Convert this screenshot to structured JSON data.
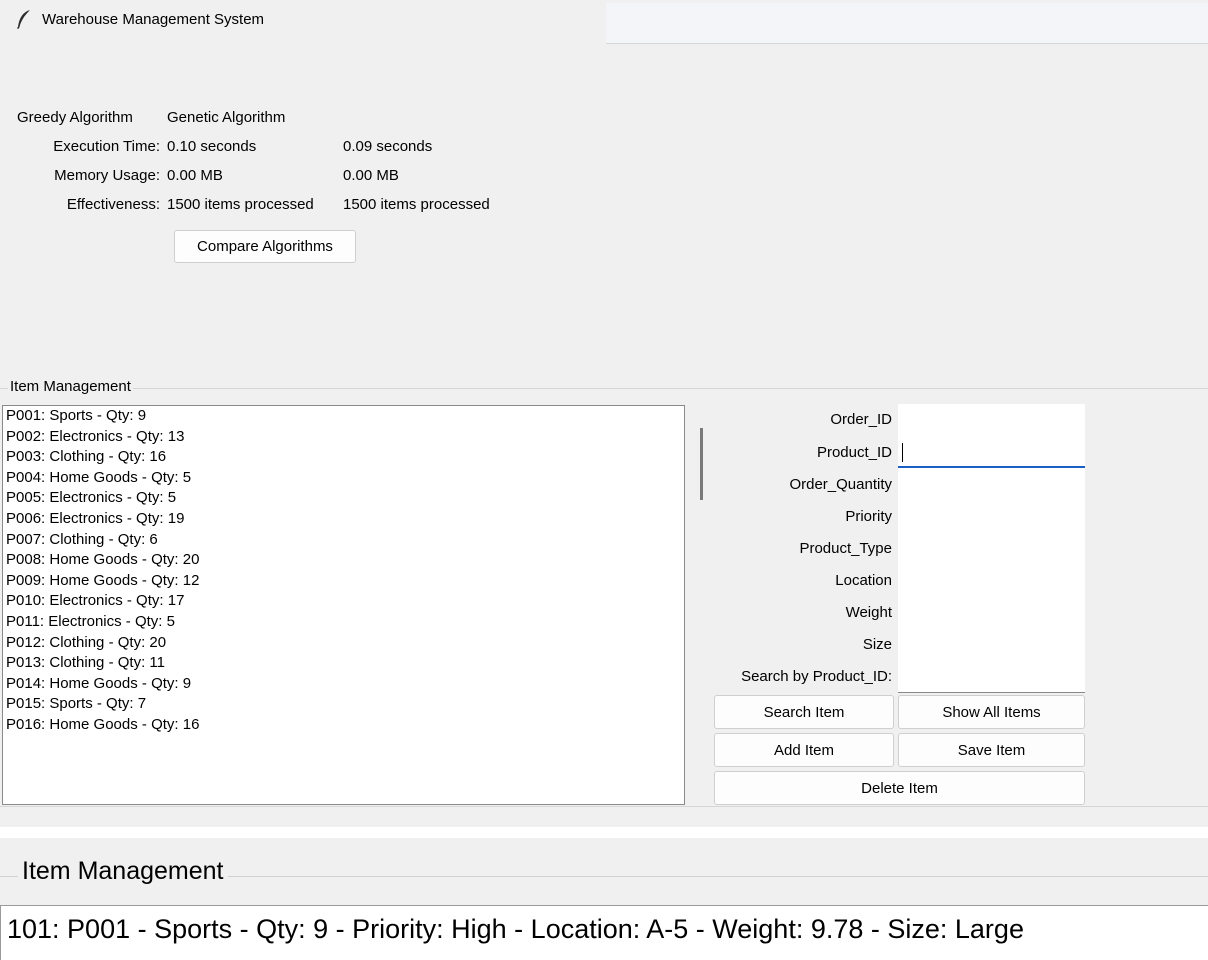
{
  "window": {
    "title": "Warehouse Management System"
  },
  "comparison": {
    "headers": {
      "greedy": "Greedy Algorithm",
      "genetic": "Genetic Algorithm"
    },
    "execution_time": {
      "label": "Execution Time:",
      "greedy": "0.10 seconds",
      "genetic": "0.09 seconds"
    },
    "memory_usage": {
      "label": "Memory Usage:",
      "greedy": "0.00 MB",
      "genetic": "0.00 MB"
    },
    "effectiveness": {
      "label": "Effectiveness:",
      "greedy": "1500 items processed",
      "genetic": "1500 items processed"
    },
    "compare_button": "Compare Algorithms"
  },
  "item_management": {
    "title": "Item Management",
    "items": [
      "P001: Sports - Qty: 9",
      "P002: Electronics - Qty: 13",
      "P003: Clothing - Qty: 16",
      "P004: Home Goods - Qty: 5",
      "P005: Electronics - Qty: 5",
      "P006: Electronics - Qty: 19",
      "P007: Clothing - Qty: 6",
      "P008: Home Goods - Qty: 20",
      "P009: Home Goods - Qty: 12",
      "P010: Electronics - Qty: 17",
      "P011: Electronics - Qty: 5",
      "P012: Clothing - Qty: 20",
      "P013: Clothing - Qty: 11",
      "P014: Home Goods - Qty: 9",
      "P015: Sports - Qty: 7",
      "P016: Home Goods - Qty: 16"
    ],
    "fields": [
      {
        "label": "Order_ID",
        "value": ""
      },
      {
        "label": "Product_ID",
        "value": ""
      },
      {
        "label": "Order_Quantity",
        "value": ""
      },
      {
        "label": "Priority",
        "value": ""
      },
      {
        "label": "Product_Type",
        "value": ""
      },
      {
        "label": "Location",
        "value": ""
      },
      {
        "label": "Weight",
        "value": ""
      },
      {
        "label": "Size",
        "value": ""
      },
      {
        "label": "Search by Product_ID:",
        "value": ""
      }
    ],
    "buttons": {
      "search": "Search Item",
      "show_all": "Show All Items",
      "add": "Add Item",
      "save": "Save Item",
      "delete": "Delete Item"
    }
  },
  "zoomed_view": {
    "title": "Item Management",
    "row": "101: P001 - Sports - Qty: 9 - Priority: High - Location: A-5 - Weight: 9.78 - Size: Large"
  }
}
